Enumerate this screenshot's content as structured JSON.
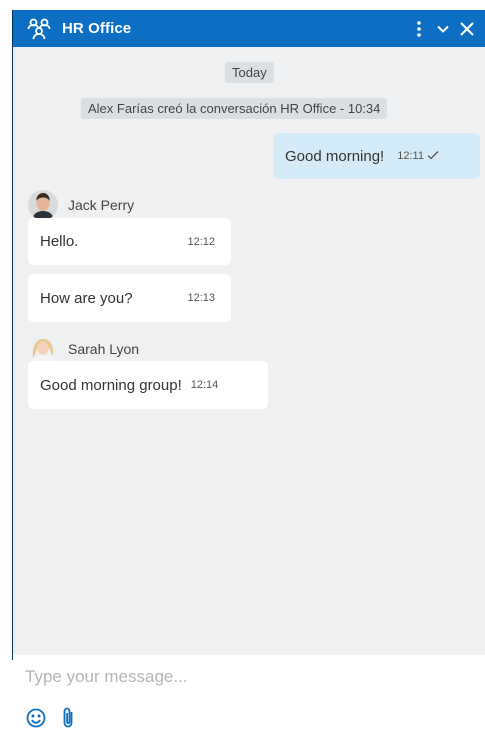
{
  "window": {
    "title": "HR Office"
  },
  "header_icons": {
    "group": "group-icon",
    "menu": "more-vertical-icon",
    "minimize": "chevron-down-icon",
    "close": "close-icon"
  },
  "messages": {
    "date_label": "Today",
    "system_text": "Alex Farías creó la conversación HR Office - 10:34",
    "own": {
      "text": "Good morning!",
      "time": "12:11",
      "status": "read-check"
    },
    "jack": {
      "name": "Jack Perry",
      "items": [
        {
          "text": "Hello.",
          "time": "12:12"
        },
        {
          "text": "How are you?",
          "time": "12:13"
        }
      ]
    },
    "sarah": {
      "name": "Sarah Lyon",
      "items": [
        {
          "text": "Good morning group!",
          "time": "12:14"
        }
      ]
    }
  },
  "composer": {
    "placeholder": "Type your message...",
    "value": "",
    "tools": [
      "emoji-icon",
      "attachment-icon"
    ]
  },
  "colors": {
    "header": "#0d6fc3",
    "own_bubble": "#d6ebf8",
    "background": "#eef0f1"
  }
}
